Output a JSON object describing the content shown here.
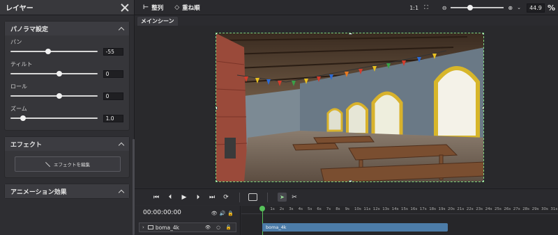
{
  "left_panel": {
    "title": "レイヤー",
    "panorama": {
      "header": "パノラマ設定",
      "sliders": [
        {
          "label": "パン",
          "value": "-55",
          "level": 0.42
        },
        {
          "label": "ティルト",
          "value": "0",
          "level": 0.55
        },
        {
          "label": "ロール",
          "value": "0",
          "level": 0.55
        },
        {
          "label": "ズーム",
          "value": "1.0",
          "level": 0.12
        }
      ]
    },
    "effect": {
      "header": "エフェクト",
      "button": "エフェクトを編集"
    },
    "animation": {
      "header": "アニメーション効果"
    }
  },
  "toolbar": {
    "align": "整列",
    "order": "重ね順",
    "ratio": "1:1",
    "zoom_value": "44.9",
    "zoom_unit": "%",
    "zoom_level": 0.32
  },
  "scene": {
    "tab": "メインシーン"
  },
  "timeline": {
    "timecode": "00:00:00:00",
    "track_name": "boma_4k",
    "clip_label": "boma_4k",
    "ruler_ticks": [
      "0",
      "1s",
      "2s",
      "3s",
      "4s",
      "5s",
      "6s",
      "7s",
      "8s",
      "9s",
      "10s",
      "11s",
      "12s",
      "13s",
      "14s",
      "15s",
      "16s",
      "17s",
      "18s",
      "19s",
      "20s",
      "21s",
      "22s",
      "23s",
      "24s",
      "25s",
      "26s",
      "27s",
      "28s",
      "29s",
      "30s",
      "31s"
    ]
  },
  "colors": {
    "accent_green": "#56c25a",
    "clip_blue": "#4c7ca8"
  }
}
